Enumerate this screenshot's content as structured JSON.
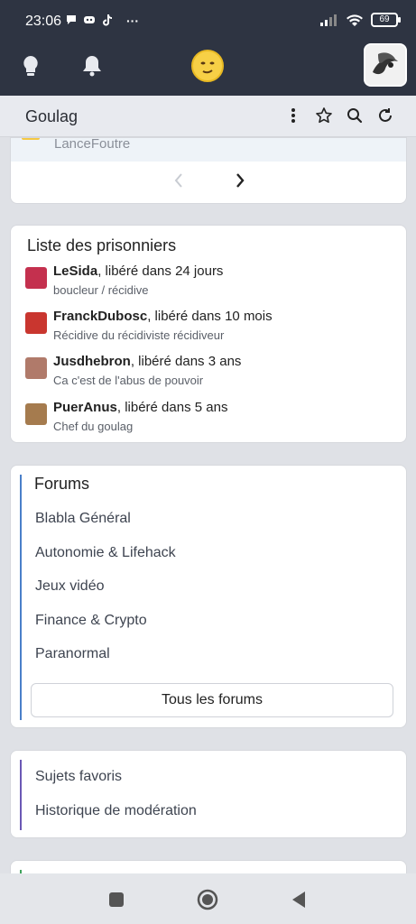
{
  "status_bar": {
    "time": "23:06",
    "notif_icons": [
      "chat-icon",
      "discord-icon",
      "tiktok-icon"
    ],
    "more": "···",
    "battery": "69"
  },
  "top_bar": {
    "icons": [
      "lightbulb-icon",
      "bell-icon",
      "smiley-avatar",
      "user-avatar"
    ]
  },
  "sub_bar": {
    "title": "Goulag",
    "tools": [
      "more-vert-icon",
      "star-icon",
      "search-icon",
      "refresh-icon"
    ]
  },
  "last_message": {
    "user": "LanceFoutre"
  },
  "prisoners": {
    "title": "Liste des prisonniers",
    "items": [
      {
        "name": "LeSida",
        "release": ", libéré dans 24 jours",
        "reason": "boucleur / récidive",
        "color": "#c4304e"
      },
      {
        "name": "FranckDubosc",
        "release": ", libéré dans 10 mois",
        "reason": "Récidive du récidiviste récidiveur",
        "color": "#c9362f"
      },
      {
        "name": "Jusdhebron",
        "release": ", libéré dans 3 ans",
        "reason": "Ca c'est de l'abus de pouvoir",
        "color": "#b07a6a"
      },
      {
        "name": "PuerAnus",
        "release": ", libéré dans 5 ans",
        "reason": "Chef du goulag",
        "color": "#a57b4e"
      }
    ]
  },
  "forums": {
    "title": "Forums",
    "items": [
      "Blabla Général",
      "Autonomie & Lifehack",
      "Jeux vidéo",
      "Finance & Crypto",
      "Paranormal"
    ],
    "all_button": "Tous les forums"
  },
  "favorites": {
    "items": [
      "Sujets favoris",
      "Historique de modération"
    ]
  },
  "nav_bar": {
    "buttons": [
      "recent-apps-button",
      "home-button",
      "back-button"
    ]
  },
  "colors": {
    "header_bg": "#2e3442",
    "forum_accent": "#4a7fc9",
    "fav_accent": "#6b58b5",
    "green_accent": "#3fa35c"
  }
}
